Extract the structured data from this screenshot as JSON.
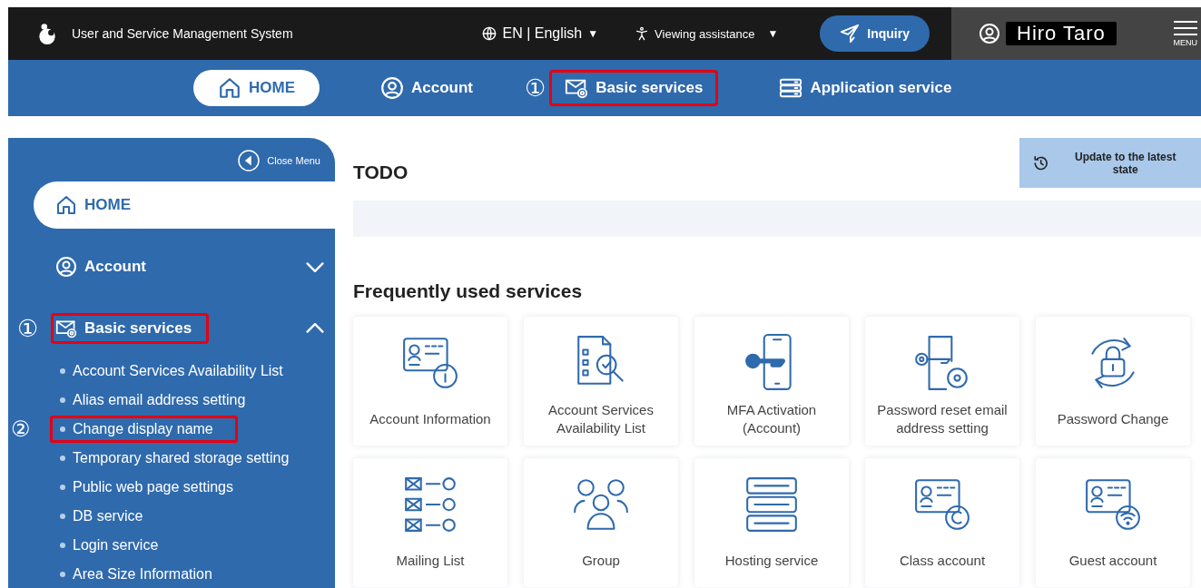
{
  "header": {
    "title": "User and Service Management System",
    "language": "EN | English",
    "language_caret": "▼",
    "viewing_assistance": "Viewing assistance",
    "viewing_caret": "▼",
    "inquiry": "Inquiry",
    "user_name": "Hiro Taro",
    "menu": "MENU"
  },
  "nav": [
    {
      "label": "HOME",
      "kind": "home",
      "selected": true,
      "highlighted": false
    },
    {
      "label": "Account",
      "kind": "user",
      "selected": false,
      "highlighted": false
    },
    {
      "label": "Basic services",
      "kind": "mail",
      "selected": false,
      "highlighted": true,
      "marker": "①"
    },
    {
      "label": "Application service",
      "kind": "server",
      "selected": false,
      "highlighted": false
    }
  ],
  "sidebar": {
    "close_menu": "Close Menu",
    "items": [
      {
        "label": "HOME",
        "kind": "home",
        "selected": true,
        "highlighted": false
      },
      {
        "label": "Account",
        "kind": "user",
        "selected": false,
        "highlighted": false,
        "expanded": false
      },
      {
        "label": "Basic services",
        "kind": "mail",
        "selected": false,
        "highlighted": true,
        "marker": "①",
        "expanded": true,
        "children": [
          {
            "label": "Account Services Availability List",
            "highlighted": false
          },
          {
            "label": "Alias email address setting",
            "highlighted": false
          },
          {
            "label": "Change display name",
            "highlighted": true,
            "marker": "②"
          },
          {
            "label": "Temporary shared storage setting",
            "highlighted": false
          },
          {
            "label": "Public web page settings",
            "highlighted": false
          },
          {
            "label": "DB service",
            "highlighted": false
          },
          {
            "label": "Login service",
            "highlighted": false
          },
          {
            "label": "Area Size Information",
            "highlighted": false
          }
        ]
      }
    ]
  },
  "main": {
    "todo_title": "TODO",
    "update_button": "Update to the latest state",
    "frequent_title": "Frequently used services",
    "services": [
      {
        "label": "Account Information",
        "kind": "id-info"
      },
      {
        "label": "Account Services Availability List",
        "kind": "doc-search"
      },
      {
        "label": "MFA Activation (Account)",
        "kind": "phone-key"
      },
      {
        "label": "Password reset email address setting",
        "kind": "phone-key-mail"
      },
      {
        "label": "Password Change",
        "kind": "lock-cycle"
      },
      {
        "label": "Mailing List",
        "kind": "mail-list"
      },
      {
        "label": "Group",
        "kind": "group"
      },
      {
        "label": "Hosting service",
        "kind": "server"
      },
      {
        "label": "Class account",
        "kind": "id-c"
      },
      {
        "label": "Guest account",
        "kind": "id-wifi"
      }
    ]
  }
}
